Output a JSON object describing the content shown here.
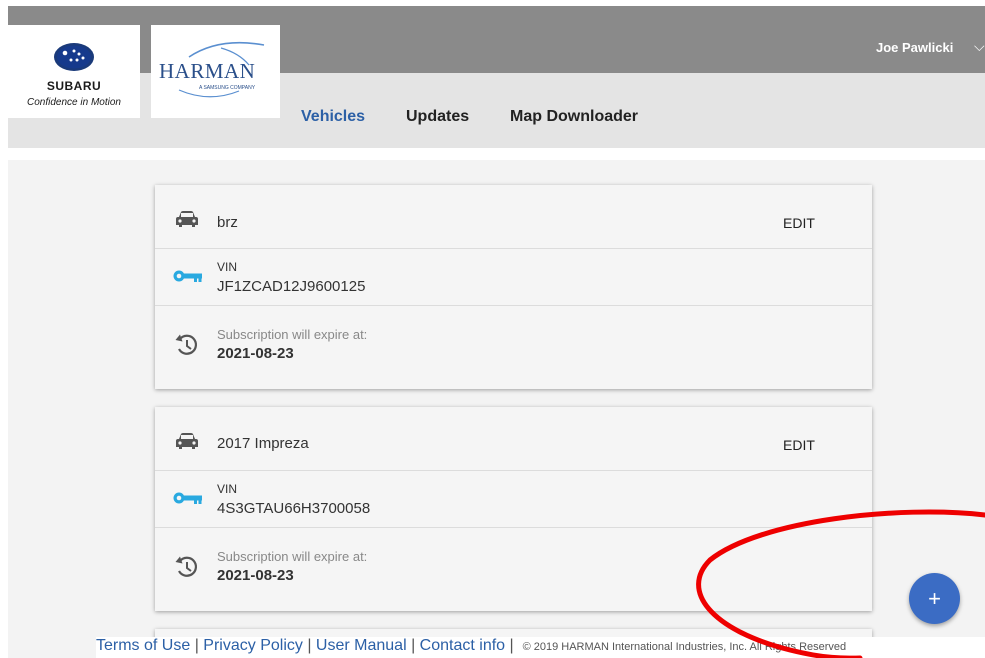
{
  "header": {
    "user_name": "Joe Pawlicki",
    "subaru": {
      "brand": "SUBARU",
      "tagline": "Confidence in Motion"
    },
    "harman": {
      "brand": "HARMAN",
      "sub": "A SAMSUNG COMPANY"
    }
  },
  "nav": {
    "tabs": [
      {
        "label": "Vehicles",
        "active": true
      },
      {
        "label": "Updates",
        "active": false
      },
      {
        "label": "Map Downloader",
        "active": false
      }
    ]
  },
  "vehicles": [
    {
      "name": "brz",
      "edit_label": "EDIT",
      "vin_label": "VIN",
      "vin": "JF1ZCAD12J9600125",
      "expire_label": "Subscription will expire at:",
      "expire_date": "2021-08-23"
    },
    {
      "name": "2017 Impreza",
      "edit_label": "EDIT",
      "vin_label": "VIN",
      "vin": "4S3GTAU66H3700058",
      "expire_label": "Subscription will expire at:",
      "expire_date": "2021-08-23"
    }
  ],
  "footer": {
    "links": [
      "Terms of Use",
      "Privacy Policy",
      "User Manual",
      "Contact info"
    ],
    "copyright": "© 2019 HARMAN International Industries, Inc. All Rights Reserved"
  },
  "fab": {
    "label": "+"
  },
  "icons": {
    "car": "car-icon",
    "key": "key-icon",
    "history": "history-icon",
    "caret": "chevron-down-icon"
  },
  "colors": {
    "accent": "#2c60a6",
    "key_icon": "#29a9e0",
    "fab": "#3b6cc4",
    "annotation": "#ee0000",
    "topbar": "#8a8a8a",
    "navbar": "#e4e4e4"
  }
}
